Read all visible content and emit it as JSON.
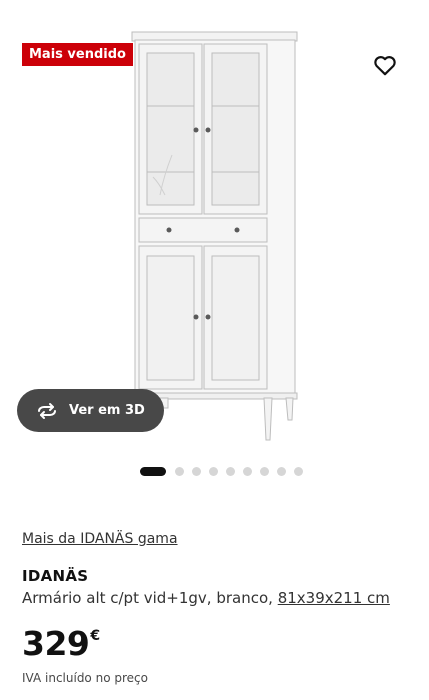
{
  "badge": {
    "text": "Mais vendido",
    "color": "#cc0008"
  },
  "favorite": {
    "icon": "heart-outline-icon"
  },
  "view3d": {
    "label": "Ver em 3D",
    "icon": "rotate-arrows-icon"
  },
  "carousel": {
    "total": 9,
    "active_index": 0
  },
  "range_link": "Mais da IDANÄS gama",
  "product": {
    "name": "IDANÄS",
    "description": "Armário alt c/pt vid+1gv, branco, ",
    "dimensions": "81x39x211 cm"
  },
  "price": {
    "amount": "329",
    "currency": "€",
    "vat_note": "IVA incluído no preço"
  }
}
